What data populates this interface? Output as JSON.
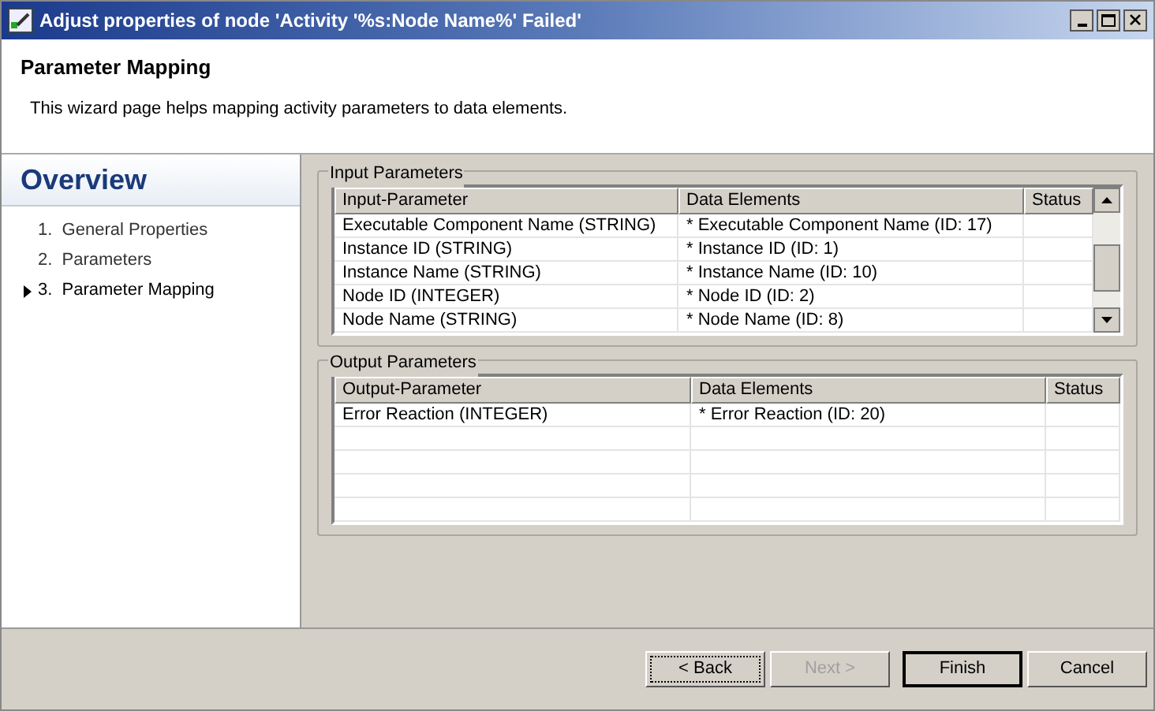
{
  "window": {
    "title": "Adjust properties of node 'Activity '%s:Node Name%' Failed'"
  },
  "header": {
    "title": "Parameter Mapping",
    "description": "This wizard page helps mapping activity parameters to data elements."
  },
  "sidebar": {
    "title": "Overview",
    "items": [
      {
        "label": "1.  General Properties",
        "selected": false
      },
      {
        "label": "2.  Parameters",
        "selected": false
      },
      {
        "label": "3.  Parameter Mapping",
        "selected": true
      }
    ]
  },
  "input_parameters": {
    "title": "Input Parameters",
    "columns": [
      "Input-Parameter",
      "Data Elements",
      "Status"
    ],
    "rows": [
      [
        "Executable Component Name  (STRING)",
        "* Executable Component Name  (ID: 17)",
        ""
      ],
      [
        "Instance ID  (STRING)",
        "* Instance ID  (ID: 1)",
        ""
      ],
      [
        "Instance Name  (STRING)",
        "* Instance Name  (ID: 10)",
        ""
      ],
      [
        "Node ID  (INTEGER)",
        "* Node ID  (ID: 2)",
        ""
      ],
      [
        "Node Name  (STRING)",
        "* Node Name  (ID: 8)",
        ""
      ]
    ]
  },
  "output_parameters": {
    "title": "Output Parameters",
    "columns": [
      "Output-Parameter",
      "Data Elements",
      "Status"
    ],
    "rows": [
      [
        "Error Reaction  (INTEGER)",
        "* Error Reaction  (ID: 20)",
        ""
      ]
    ]
  },
  "buttons": [
    {
      "label": "< Back",
      "focused": true,
      "disabled": false,
      "default": false
    },
    {
      "label": "Next >",
      "focused": false,
      "disabled": true,
      "default": false
    },
    {
      "label": "Finish",
      "focused": false,
      "disabled": false,
      "default": true
    },
    {
      "label": "Cancel",
      "focused": false,
      "disabled": false,
      "default": false
    }
  ]
}
